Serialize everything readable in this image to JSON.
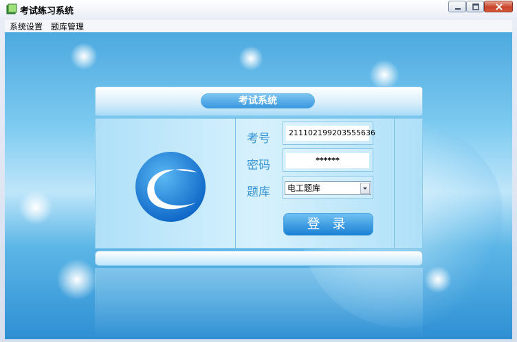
{
  "window": {
    "title": "考试练习系统"
  },
  "menu": {
    "items": [
      "系统设置",
      "题库管理"
    ]
  },
  "panel": {
    "title": "考试系统"
  },
  "form": {
    "exam_no_label": "考号",
    "exam_no_value": "211102199203555636",
    "password_label": "密码",
    "password_value": "******",
    "bank_label": "题库",
    "bank_value": "电工题库",
    "login_label": "登 录"
  },
  "icons": [
    "app-icon",
    "minimize-icon",
    "maximize-icon",
    "close-icon",
    "chevron-down-icon",
    "logo-icon"
  ],
  "colors": {
    "accent": "#3a95d2",
    "button": "#1b80d4"
  }
}
